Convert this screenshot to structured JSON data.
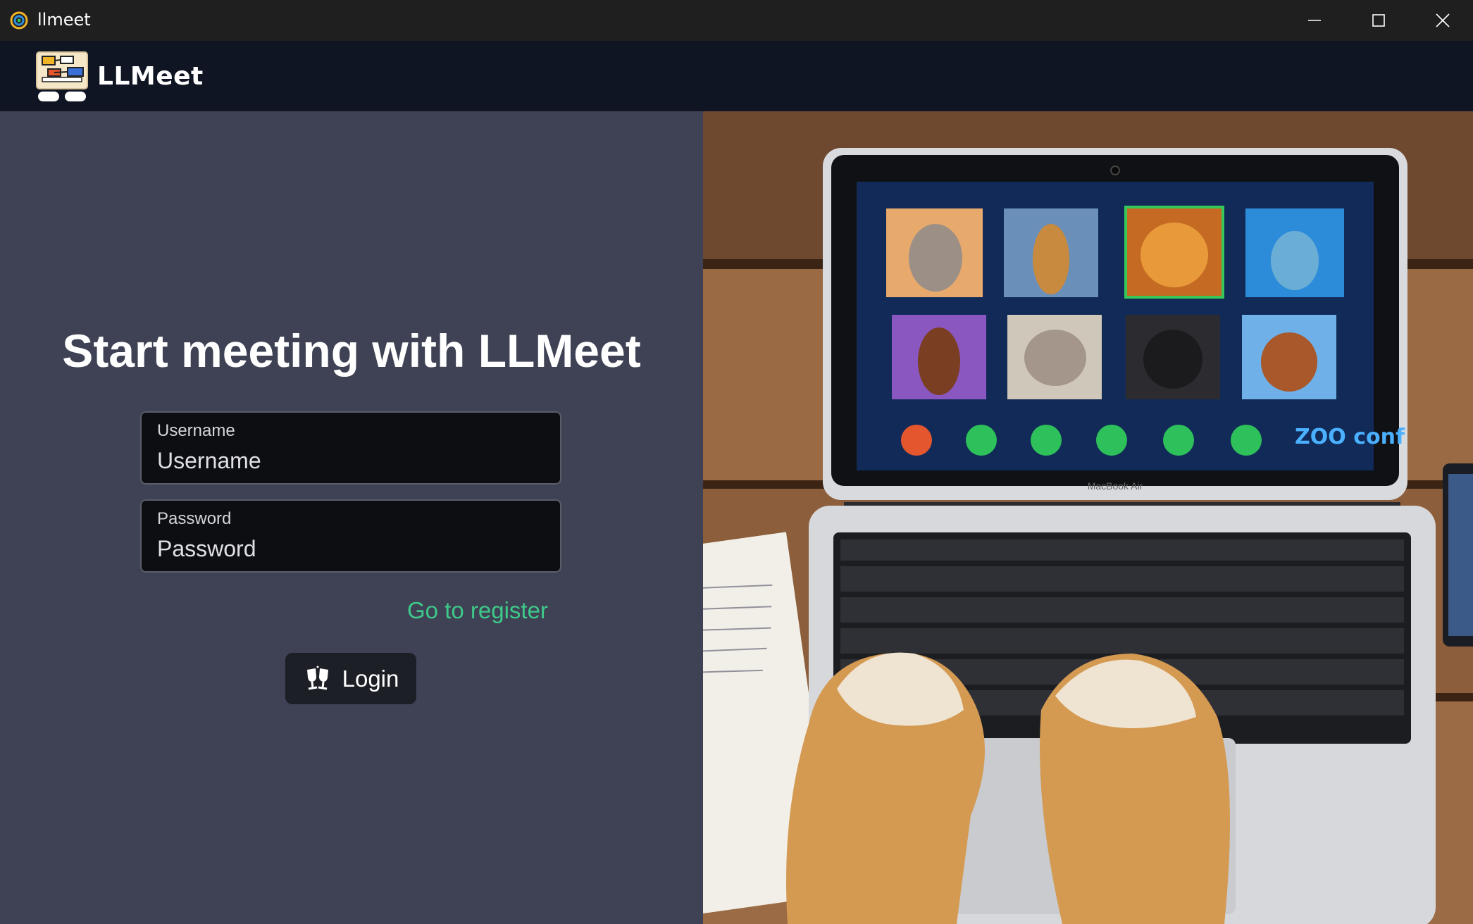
{
  "window": {
    "title": "llmeet",
    "app_icon": "llmeet-app-icon",
    "controls": {
      "minimize_icon": "minimize-icon",
      "maximize_icon": "maximize-icon",
      "close_icon": "close-icon"
    }
  },
  "header": {
    "logo_icon": "llmeet-logo-icon",
    "brand": "LLMeet"
  },
  "login": {
    "headline": "Start meeting with LLMeet",
    "username": {
      "label": "Username",
      "placeholder": "Username",
      "value": ""
    },
    "password": {
      "label": "Password",
      "placeholder": "Password",
      "value": ""
    },
    "register_link": "Go to register",
    "login_button": {
      "label": "Login",
      "icon": "cheers-glasses-icon"
    }
  },
  "hero": {
    "laptop_brand": "MacBook Air",
    "conference_logo": "ZOO conf",
    "colors": {
      "call_end": "#e4572e",
      "call_action": "#2ec05a"
    }
  },
  "colors": {
    "panel": "#3e4254",
    "appbar": "#0f1523",
    "accent_link": "#3ec98a",
    "input_bg": "#0d0e12"
  }
}
